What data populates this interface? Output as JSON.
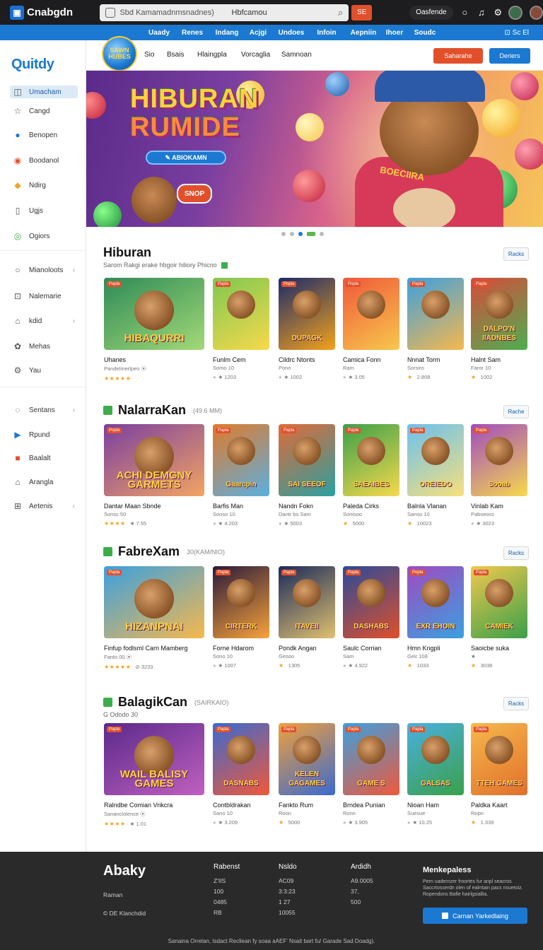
{
  "topbar": {
    "logo_letter": "▣",
    "logo_text": "Cnabgdn",
    "search_placeholder": "Sbd Kamamadnmsnadnes)",
    "search_value": "Hbfcamou",
    "lang_label": "SE",
    "account_label": "Oasfende"
  },
  "catnav": {
    "items": [
      "Uaady",
      "Renes",
      "Indang",
      "Acjgi",
      "Undoes",
      "Infoin",
      "Aepniin",
      "Ihoer",
      "Soudc"
    ],
    "right_label": "⊡ Sc El"
  },
  "sidebar": {
    "logo": "Quitdy",
    "items": [
      {
        "icon": "◫",
        "label": "Umacham"
      },
      {
        "icon": "☆",
        "label": "Cangd"
      },
      {
        "icon": "●",
        "label": "Benopen"
      },
      {
        "icon": "◉",
        "label": "Boodanol"
      },
      {
        "icon": "◆",
        "label": "Ndirg"
      },
      {
        "icon": "▯",
        "label": "Ugjs"
      },
      {
        "icon": "◎",
        "label": "Ogiors"
      },
      {
        "icon": "○",
        "label": "Mianoloots"
      },
      {
        "icon": "⊡",
        "label": "Nalemarie"
      },
      {
        "icon": "⌂",
        "label": "kdid"
      },
      {
        "icon": "✿",
        "label": "Mehas"
      },
      {
        "icon": "⚙",
        "label": "Yau"
      },
      {
        "icon": "◌",
        "label": "Sentans"
      },
      {
        "icon": "▶",
        "label": "Rpund"
      },
      {
        "icon": "■",
        "label": "Baalalt"
      },
      {
        "icon": "⌂",
        "label": "Arangla"
      },
      {
        "icon": "⊞",
        "label": "Aetenis"
      }
    ]
  },
  "subheader": {
    "badge_text": "SAWN HUBES",
    "links": [
      "Sio",
      "Bsais",
      "Hlaingpla",
      "Vorcaglia",
      "Samnoan"
    ],
    "btn_primary": "Saharahe",
    "btn_secondary": "Deriers"
  },
  "hero": {
    "title_line1": "HIBURAN",
    "title_line2": "RUMIDE",
    "cta_label": "✎ ABIOKAMN",
    "bubble_label": "SNOP",
    "shirt_text": "BOECIIRA"
  },
  "sections": [
    {
      "title": "Hiburan",
      "subtitle": "",
      "note": "Sarom Rakgi erake hbgoir hiliory Phicno",
      "more": "Racks",
      "cards": [
        {
          "tag": "Papla",
          "art": "HIBAQURRI",
          "title": "Uhanes",
          "sub": "Pandelmerlpen ⦿",
          "stars": "★★★★★",
          "meta": "",
          "c1": "#2e8b57",
          "c2": "#a3d977"
        },
        {
          "tag": "Papla",
          "art": "",
          "title": "Funlm Cem",
          "sub": "Somo 10",
          "stars": "",
          "meta": "★ 1203",
          "c1": "#7ec850",
          "c2": "#f7d94c"
        },
        {
          "tag": "Popla",
          "art": "DUPAGK",
          "title": "Cildrc Ntonts",
          "sub": "Ponn",
          "stars": "",
          "meta": "★ 1002",
          "c1": "#1b2a6a",
          "c2": "#f3a21b"
        },
        {
          "tag": "Popla",
          "art": "",
          "title": "Camica Fonn",
          "sub": "Ram",
          "stars": "",
          "meta": "★ 3.05",
          "c1": "#f0583a",
          "c2": "#f7c84c"
        },
        {
          "tag": "Papla",
          "art": "",
          "title": "Nnnat Torm",
          "sub": "Sorsiro",
          "stars": "★",
          "meta": "2.808",
          "c1": "#3aa0e0",
          "c2": "#f7b84c"
        },
        {
          "tag": "Papla",
          "art": "DALPO'N IIADNBES",
          "title": "Halnt Sam",
          "sub": "Faror 10",
          "stars": "★",
          "meta": "1002",
          "c1": "#d94a3a",
          "c2": "#4caf50"
        }
      ]
    },
    {
      "title": "NalarraKan",
      "subtitle": "(49.6 MM)",
      "note": "",
      "more": "Rache",
      "cards": [
        {
          "tag": "Popla",
          "art": "ACHI DEMGNY GARMETS",
          "title": "Dantar Maan Sbnde",
          "sub": "Sonsc 50",
          "stars": "★★★★",
          "meta": "★ 7.55",
          "c1": "#7a3fa0",
          "c2": "#f3a462"
        },
        {
          "tag": "Papla",
          "art": "Gaarcpin",
          "title": "Barfis Man",
          "sub": "Sonso 10",
          "stars": "",
          "meta": "★ 4.203",
          "c1": "#e07a2a",
          "c2": "#5ab0e0"
        },
        {
          "tag": "Papla",
          "art": "SAI SEEOF",
          "title": "Nandn Fokn",
          "sub": "Dantr bs Sam",
          "stars": "",
          "meta": "★ 5003",
          "c1": "#e06a3a",
          "c2": "#2aa0a0"
        },
        {
          "tag": "Papla",
          "art": "SAEAIBES",
          "title": "Paleda Cirks",
          "sub": "Sonisoo",
          "stars": "★",
          "meta": "5000",
          "c1": "#3aa04a",
          "c2": "#f7d94c"
        },
        {
          "tag": "Papla",
          "art": "OREIEDO",
          "title": "Balnla Vlanan",
          "sub": "Sanso 10",
          "stars": "★",
          "meta": "10023",
          "c1": "#6ac0f0",
          "c2": "#f7e07c"
        },
        {
          "tag": "Papla",
          "art": "Sooab",
          "title": "Vinlab Kam",
          "sub": "Pabseoss",
          "stars": "",
          "meta": "★ 3023",
          "c1": "#a04ac0",
          "c2": "#f7d94c"
        }
      ]
    },
    {
      "title": "FabreXam",
      "subtitle": "30(KAM/NIO)",
      "note": "",
      "more": "Racks",
      "cards": [
        {
          "tag": "Papla",
          "art": "HIZANPNAI",
          "title": "Finfup fodlsml Carn Mamberg",
          "sub": "Fanto 00 ⦿",
          "stars": "★★★★★",
          "meta": "⊘ 3233",
          "c1": "#3aa0e0",
          "c2": "#f7b84c"
        },
        {
          "tag": "Papla",
          "art": "CIRTERK",
          "title": "Forne Hdarom",
          "sub": "Sono 10",
          "stars": "",
          "meta": "★ 1007",
          "c1": "#2a1a3a",
          "c2": "#f7a23a"
        },
        {
          "tag": "Papla",
          "art": "ITAVEII",
          "title": "Pondk Angan",
          "sub": "Gesoo",
          "stars": "★",
          "meta": "1305",
          "c1": "#1a2a5a",
          "c2": "#e0c070"
        },
        {
          "tag": "Papla",
          "art": "DASHABS",
          "title": "Saulc Corrian",
          "sub": "Sam",
          "stars": "",
          "meta": "★ 4.922",
          "c1": "#2a4a9a",
          "c2": "#e0502a"
        },
        {
          "tag": "Popla",
          "art": "EXR EHOIN",
          "title": "Hmn Kngpli",
          "sub": "Geir 108",
          "stars": "★",
          "meta": "1033",
          "c1": "#a04ac0",
          "c2": "#3aa0e0"
        },
        {
          "tag": "Papla",
          "art": "CAMIEK",
          "title": "Saoicbe suka",
          "sub": "★",
          "stars": "★",
          "meta": "3038",
          "c1": "#f0c84c",
          "c2": "#3aa04a"
        }
      ]
    },
    {
      "title": "BalagikCan",
      "subtitle": "(SAIRKAIO)",
      "note": "G Ododo 30",
      "more": "Racks",
      "cards": [
        {
          "tag": "Papla",
          "art": "WAIL BALISY GAMES",
          "title": "Ralndbe Comian Vrikcra",
          "sub": "Sananclolence ⦿",
          "stars": "★★★★",
          "meta": "★ 1.01",
          "c1": "#5a2a8a",
          "c2": "#c060c0"
        },
        {
          "tag": "Papla",
          "art": "DASNABS",
          "title": "Contbldrakan",
          "sub": "Sano 10",
          "stars": "",
          "meta": "★ 3.209",
          "c1": "#3a6ad0",
          "c2": "#f0583a"
        },
        {
          "tag": "Papla",
          "art": "KELEN GAGAMES",
          "title": "Fankto Rum",
          "sub": "Roon",
          "stars": "★",
          "meta": "5000",
          "c1": "#f0a03a",
          "c2": "#3a6ad0"
        },
        {
          "tag": "Papla",
          "art": "GAME S",
          "title": "Brndea Punian",
          "sub": "Ronn",
          "stars": "",
          "meta": "★ 3.905",
          "c1": "#3aa0e0",
          "c2": "#f0583a"
        },
        {
          "tag": "Papla",
          "art": "GALSAS",
          "title": "Nioan Ham",
          "sub": "Suesue",
          "stars": "",
          "meta": "★ 10.25",
          "c1": "#4ab0e0",
          "c2": "#3aa04a"
        },
        {
          "tag": "Papla",
          "art": "TTEH GAMES",
          "title": "Paldka Kaart",
          "sub": "Ropn",
          "stars": "★",
          "meta": "1.339",
          "c1": "#f7b84c",
          "c2": "#e0702a"
        }
      ]
    }
  ],
  "footer": {
    "brand": "Abaky",
    "brand_sub": "Raman",
    "brand_copy": "© DE Klanchdid",
    "cols": [
      {
        "head": "Rabenst",
        "lines": [
          "Z'IIS",
          "100",
          "0485",
          "RB"
        ]
      },
      {
        "head": "Nsldo",
        "lines": [
          "AC09",
          "3:3:23",
          "1 27",
          "10055"
        ]
      },
      {
        "head": "Ardidh",
        "lines": [
          "A9.0005",
          "37,",
          "500",
          ""
        ]
      }
    ],
    "newsletter_title": "Menkepaless",
    "newsletter_text": "Pern uadernzer froortes fur anpl seacros Saccrtosserdn olen of ealrrtain pacs nsuetoiz. Ropendons Bafie hairlgsiallia.",
    "newsletter_btn": "Carnan Yarkedlaing",
    "copyright": "Sanaina Orrelan, Isdact Recliean fy soaa aAEF' Nsait bart fu/ Garade Sad Doadg)."
  }
}
